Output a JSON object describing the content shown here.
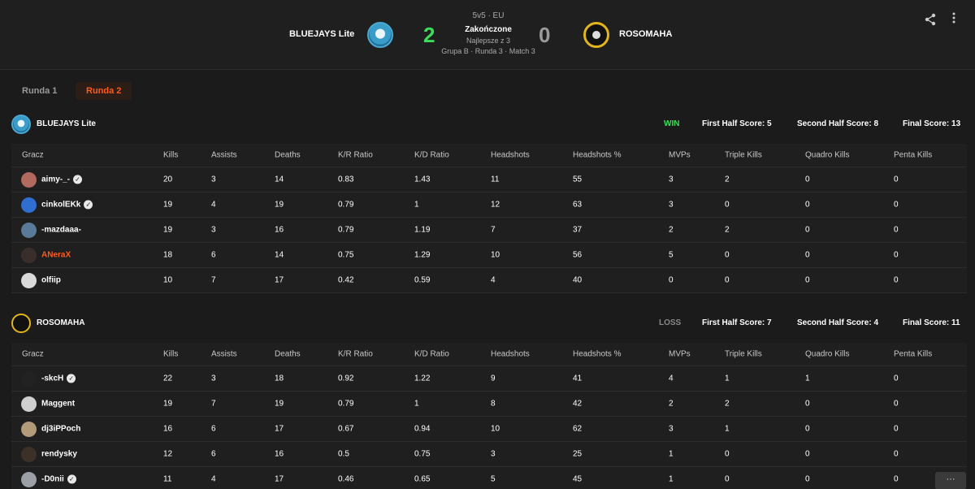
{
  "header": {
    "team_left": "BLUEJAYS Lite",
    "team_right": "ROSOMAHA",
    "score_left": "2",
    "score_right": "0",
    "mode": "5v5 · EU",
    "status": "Zakończone",
    "best_of": "Najlepsze z 3",
    "meta": "Grupa B · Runda 3 · Match 3"
  },
  "tabs": [
    {
      "label": "Runda 1",
      "active": false
    },
    {
      "label": "Runda 2",
      "active": true
    }
  ],
  "columns": [
    "Gracz",
    "Kills",
    "Assists",
    "Deaths",
    "K/R Ratio",
    "K/D Ratio",
    "Headshots",
    "Headshots %",
    "MVPs",
    "Triple Kills",
    "Quadro Kills",
    "Penta Kills"
  ],
  "teams": [
    {
      "name": "BLUEJAYS Lite",
      "result": "WIN",
      "first_half": "First Half Score: 5",
      "second_half": "Second Half Score: 8",
      "final": "Final Score: 13",
      "players": [
        {
          "name": "aimy-_-",
          "verified": true,
          "color": "#ffffff",
          "avatar": "#b36a5e",
          "stats": [
            "20",
            "3",
            "14",
            "0.83",
            "1.43",
            "11",
            "55",
            "3",
            "2",
            "0",
            "0"
          ]
        },
        {
          "name": "cinkolEKk",
          "verified": true,
          "color": "#ffffff",
          "avatar": "#2f6fd1",
          "stats": [
            "19",
            "4",
            "19",
            "0.79",
            "1",
            "12",
            "63",
            "3",
            "0",
            "0",
            "0"
          ]
        },
        {
          "name": "-mazdaaa-",
          "verified": false,
          "color": "#ffffff",
          "avatar": "#5a7a99",
          "stats": [
            "19",
            "3",
            "16",
            "0.79",
            "1.19",
            "7",
            "37",
            "2",
            "2",
            "0",
            "0"
          ]
        },
        {
          "name": "ANeraX",
          "verified": false,
          "color": "#ff5a1f",
          "avatar": "#3a2e2a",
          "stats": [
            "18",
            "6",
            "14",
            "0.75",
            "1.29",
            "10",
            "56",
            "5",
            "0",
            "0",
            "0"
          ]
        },
        {
          "name": "olfiip",
          "verified": false,
          "color": "#ffffff",
          "avatar": "#d9d9d9",
          "stats": [
            "10",
            "7",
            "17",
            "0.42",
            "0.59",
            "4",
            "40",
            "0",
            "0",
            "0",
            "0"
          ]
        }
      ]
    },
    {
      "name": "ROSOMAHA",
      "result": "LOSS",
      "first_half": "First Half Score: 7",
      "second_half": "Second Half Score: 4",
      "final": "Final Score: 11",
      "players": [
        {
          "name": "-skcH",
          "verified": true,
          "color": "#ffffff",
          "avatar": "#222222",
          "stats": [
            "22",
            "3",
            "18",
            "0.92",
            "1.22",
            "9",
            "41",
            "4",
            "1",
            "1",
            "0"
          ]
        },
        {
          "name": "Maggent",
          "verified": false,
          "color": "#ffffff",
          "avatar": "#cfcfcf",
          "stats": [
            "19",
            "7",
            "19",
            "0.79",
            "1",
            "8",
            "42",
            "2",
            "2",
            "0",
            "0"
          ]
        },
        {
          "name": "dj3iPPoch",
          "verified": false,
          "color": "#ffffff",
          "avatar": "#b39b7a",
          "stats": [
            "16",
            "6",
            "17",
            "0.67",
            "0.94",
            "10",
            "62",
            "3",
            "1",
            "0",
            "0"
          ]
        },
        {
          "name": "rendysky",
          "verified": false,
          "color": "#ffffff",
          "avatar": "#3d3028",
          "stats": [
            "12",
            "6",
            "16",
            "0.5",
            "0.75",
            "3",
            "25",
            "1",
            "0",
            "0",
            "0"
          ]
        },
        {
          "name": "-D0nii",
          "verified": true,
          "color": "#ffffff",
          "avatar": "#9aa0a6",
          "stats": [
            "11",
            "4",
            "17",
            "0.46",
            "0.65",
            "5",
            "45",
            "1",
            "0",
            "0",
            "0"
          ]
        }
      ]
    }
  ],
  "chat_label": "···"
}
